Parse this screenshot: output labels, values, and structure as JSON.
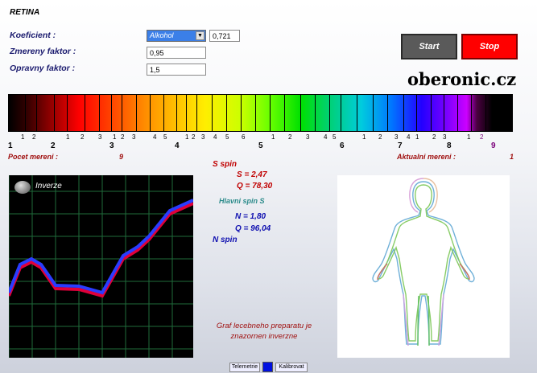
{
  "app": {
    "title": "RETINA"
  },
  "form": {
    "koeficient_label": "Koeficient :",
    "koeficient_select": "Alkohol",
    "koeficient_value": "0,721",
    "zmereny_label": "Zmereny faktor :",
    "zmereny_value": "0,95",
    "opravny_label": "Opravny faktor :",
    "opravny_value": "1,5"
  },
  "buttons": {
    "start": "Start",
    "stop": "Stop",
    "telemetrie": "Telemetrie",
    "kalibrovat": "Kalibrovat"
  },
  "logo": "oberonic.cz",
  "spectrum": {
    "small_numbers": [
      "1",
      "2",
      "1",
      "2",
      "3",
      "1",
      "2",
      "3",
      "4",
      "5",
      "1",
      "2",
      "3",
      "4",
      "5",
      "6",
      "1",
      "2",
      "3",
      "4",
      "5",
      "1",
      "2",
      "3",
      "4",
      "1",
      "2",
      "3",
      "1",
      "2"
    ],
    "big_numbers": [
      "1",
      "2",
      "3",
      "4",
      "5",
      "6",
      "7",
      "8",
      "9"
    ]
  },
  "stats": {
    "pocet_label": "Pocet mereni :",
    "pocet_value": "9",
    "aktualni_label": "Aktualni mereni :",
    "aktualni_value": "1"
  },
  "spins": {
    "s_spin_label": "S spin",
    "s_value": "S = 2,47",
    "s_q": "Q = 78,30",
    "hlavni_label": "Hlavni spin S",
    "n_value": "N = 1,80",
    "n_q": "Q = 96,04",
    "n_spin_label": "N spin"
  },
  "graph": {
    "toggle_label": "Inverze",
    "caption_line1": "Graf lecebneho preparatu je",
    "caption_line2": "znazornen inverzne"
  },
  "colors": {
    "stop_button": "#ff0000",
    "start_button": "#5a5a5a",
    "graph_bg": "#000000",
    "line_red": "#e0003a",
    "line_blue": "#2a3cff"
  }
}
